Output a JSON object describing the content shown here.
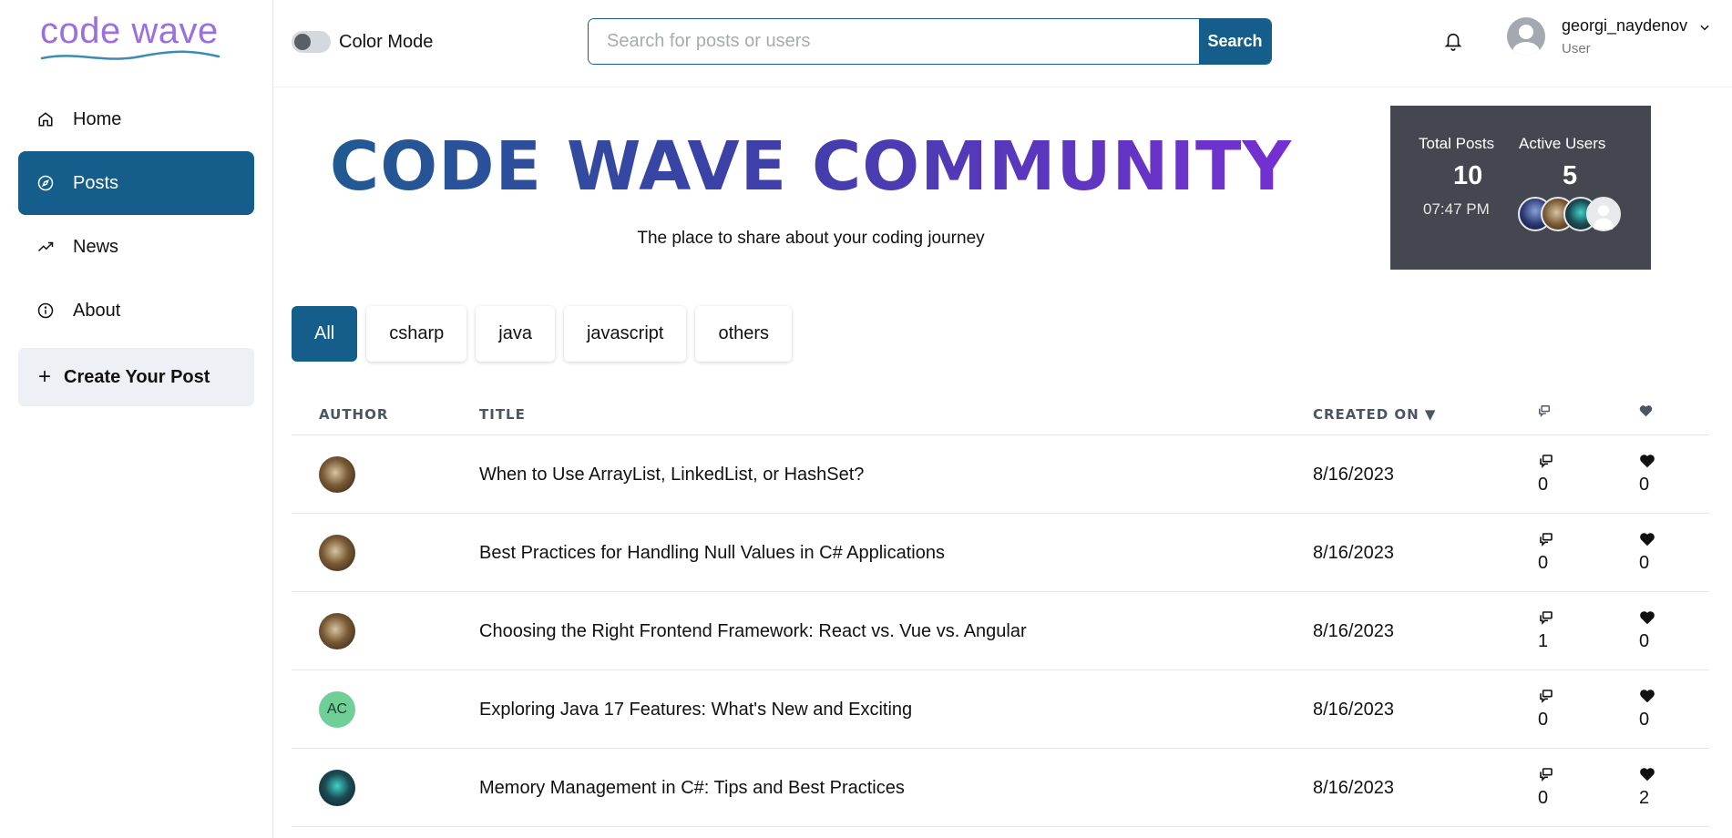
{
  "app": {
    "logo_text": "code wave"
  },
  "sidebar": {
    "items": [
      {
        "label": "Home",
        "icon": "home-icon",
        "active": false
      },
      {
        "label": "Posts",
        "icon": "compass-icon",
        "active": true
      },
      {
        "label": "News",
        "icon": "trending-up-icon",
        "active": false
      },
      {
        "label": "About",
        "icon": "info-icon",
        "active": false
      }
    ],
    "create_label": "Create Your Post"
  },
  "header": {
    "color_mode_label": "Color Mode",
    "search_placeholder": "Search for posts or users",
    "search_button": "Search",
    "user": {
      "name": "georgi_naydenov",
      "role": "User"
    }
  },
  "hero": {
    "title": "CODE WAVE COMMUNITY",
    "subtitle": "The place to share about your coding journey"
  },
  "stats": {
    "total_posts_label": "Total Posts",
    "total_posts_value": "10",
    "time": "07:47 PM",
    "active_users_label": "Active Users",
    "active_users_value": "5"
  },
  "tags": [
    {
      "label": "All",
      "active": true
    },
    {
      "label": "csharp",
      "active": false
    },
    {
      "label": "java",
      "active": false
    },
    {
      "label": "javascript",
      "active": false
    },
    {
      "label": "others",
      "active": false
    }
  ],
  "table": {
    "headers": {
      "author": "AUTHOR",
      "title": "TITLE",
      "created_on": "CREATED ON ▼"
    },
    "rows": [
      {
        "avatar": "photo-brown",
        "title": "When to Use ArrayList, LinkedList, or HashSet?",
        "date": "8/16/2023",
        "comments": "0",
        "likes": "0"
      },
      {
        "avatar": "photo-brown",
        "title": "Best Practices for Handling Null Values in C# Applications",
        "date": "8/16/2023",
        "comments": "0",
        "likes": "0"
      },
      {
        "avatar": "photo-brown",
        "title": "Choosing the Right Frontend Framework: React vs. Vue vs. Angular",
        "date": "8/16/2023",
        "comments": "1",
        "likes": "0"
      },
      {
        "avatar": "initials",
        "initials": "AC",
        "title": "Exploring Java 17 Features: What's New and Exciting",
        "date": "8/16/2023",
        "comments": "0",
        "likes": "0"
      },
      {
        "avatar": "photo-dark",
        "title": "Memory Management in C#: Tips and Best Practices",
        "date": "8/16/2023",
        "comments": "0",
        "likes": "2"
      }
    ]
  },
  "colors": {
    "primary": "#155e8c",
    "logo": "#9b6fe0",
    "stats_bg": "#444750"
  }
}
